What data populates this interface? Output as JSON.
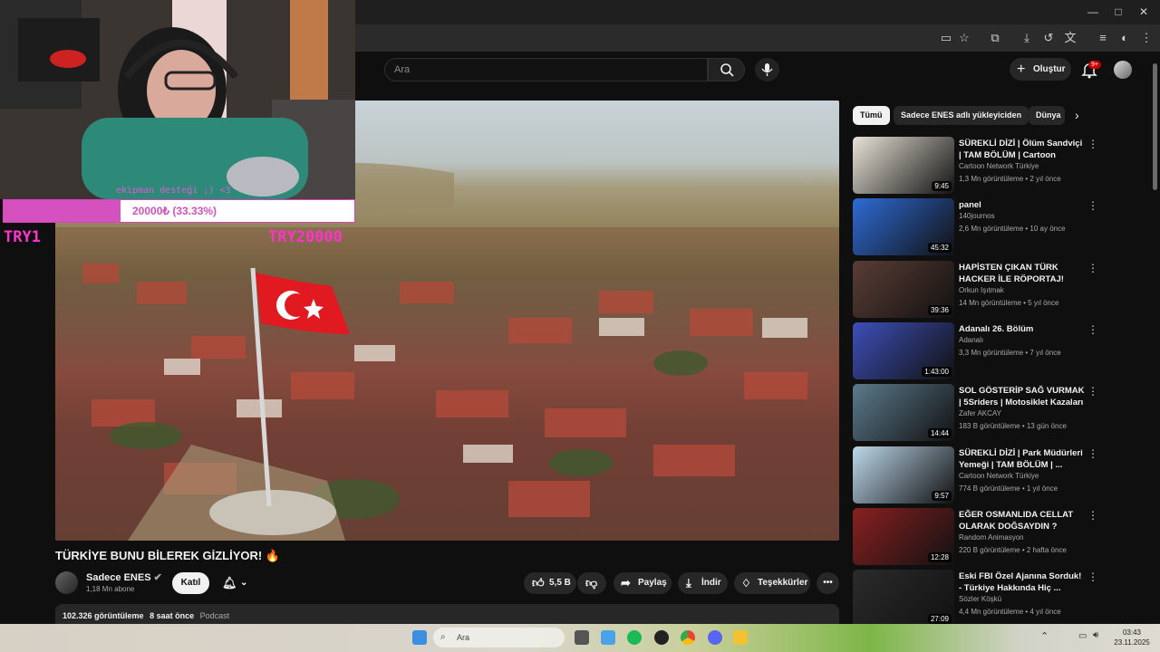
{
  "browser": {
    "window_controls": [
      "—",
      "□",
      "✕"
    ]
  },
  "header": {
    "search_placeholder": "Ara",
    "create_label": "Oluştur",
    "notification_badge": "9+"
  },
  "overlay": {
    "donation_label": "ekipman desteği ;) <3",
    "donation_progress_text": "20000₺ (33.33%)",
    "donation_progress_fraction": 0.3333,
    "try_left": "TRY1",
    "try_right": "TRY20000"
  },
  "video": {
    "title": "TÜRKİYE BUNU BİLEREK GİZLİYOR! 🔥",
    "channel": "Sadece ENES",
    "subscribers": "1,18 Mn abone",
    "join_label": "Katıl",
    "likes": "5,5 B",
    "share_label": "Paylaş",
    "download_label": "İndir",
    "thanks_label": "Teşekkürler",
    "views": "102.326 görüntüleme",
    "age": "8 saat önce",
    "category": "Podcast"
  },
  "chips": [
    "Tümü",
    "Sadece ENES adlı yükleyiciden",
    "Dünya"
  ],
  "recommendations": [
    {
      "title": "SÜREKLİ DİZİ | Ölüm Sandviçi | TAM BÖLÜM | Cartoon Networ...",
      "channel": "Cartoon Network Türkiye",
      "meta": "1,3 Mn görüntüleme • 2 yıl önce",
      "duration": "9:45",
      "thumb_color": "#e8e3d8"
    },
    {
      "title": "panel",
      "channel": "140journos",
      "meta": "2,6 Mn görüntüleme • 10 ay önce",
      "duration": "45:32",
      "thumb_color": "#2f6bd6"
    },
    {
      "title": "HAPİSTEN ÇIKAN TÜRK HACKER İLE RÖPORTAJ!",
      "channel": "Orkun Işıtmak",
      "meta": "14 Mn görüntüleme • 5 yıl önce",
      "duration": "39:36",
      "thumb_color": "#5a3d35"
    },
    {
      "title": "Adanalı 26. Bölüm",
      "channel": "Adanalı",
      "meta": "3,3 Mn görüntüleme • 7 yıl önce",
      "duration": "1:43:00",
      "thumb_color": "#3d4fb8"
    },
    {
      "title": "SOL GÖSTERİP SAĞ VURMAK | 5Sriders | Motosiklet Kazaları ...",
      "channel": "Zafer AKCAY",
      "meta": "183 B görüntüleme • 13 gün önce",
      "duration": "14:44",
      "thumb_color": "#5b7a8c"
    },
    {
      "title": "SÜREKLİ DİZİ | Park Müdürleri Yemeği | TAM BÖLÜM | ...",
      "channel": "Cartoon Network Türkiye",
      "meta": "774 B görüntüleme • 1 yıl önce",
      "duration": "9:57",
      "thumb_color": "#bcd8ea"
    },
    {
      "title": "EĞER OSMANLIDA CELLAT OLARAK DOĞSAYDIN ?",
      "channel": "Random Animasyon",
      "meta": "220 B görüntüleme • 2 hafta önce",
      "duration": "12:28",
      "thumb_color": "#8a2020"
    },
    {
      "title": "Eski FBI Özel Ajanına Sorduk! - Türkiye Hakkında Hiç ...",
      "channel": "Sözler Köşkü",
      "meta": "4,4 Mn görüntüleme • 4 yıl önce",
      "duration": "27:09",
      "thumb_color": "#2b2b2b"
    }
  ],
  "taskbar": {
    "search_label": "Ara",
    "time": "03:43",
    "date": "23.11.2025"
  }
}
